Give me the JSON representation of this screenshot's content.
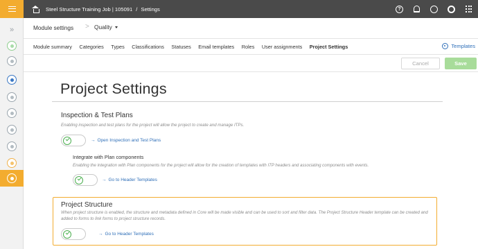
{
  "topbar": {
    "breadcrumb_job": "Steel Structure Training Job | 105091",
    "breadcrumb_sep": "/",
    "breadcrumb_page": "Settings",
    "help_glyph": "?",
    "icons": [
      "home-icon",
      "help-icon",
      "bell-icon",
      "user-icon",
      "settings-icon",
      "apps-grid-icon"
    ]
  },
  "rail": {
    "collapse_glyph": "»",
    "accent_color": "#f3ac2f"
  },
  "module": {
    "title": "Module settings",
    "separator": ">",
    "selected_module": "Quality"
  },
  "tabs": [
    {
      "label": "Module summary",
      "active": false
    },
    {
      "label": "Categories",
      "active": false
    },
    {
      "label": "Types",
      "active": false
    },
    {
      "label": "Classifications",
      "active": false
    },
    {
      "label": "Statuses",
      "active": false
    },
    {
      "label": "Email templates",
      "active": false
    },
    {
      "label": "Roles",
      "active": false
    },
    {
      "label": "User assignments",
      "active": false
    },
    {
      "label": "Project Settings",
      "active": true
    }
  ],
  "templates_link": "Templates",
  "actions": {
    "cancel_label": "Cancel",
    "save_label": "Save"
  },
  "page": {
    "title": "Project Settings"
  },
  "itp": {
    "title": "Inspection & Test Plans",
    "description": "Enabling inspection and test plans for the project will allow the project to create and manage ITPs.",
    "toggle_on": true,
    "link_label": "Open Inspection and Test Plans",
    "plan_components": {
      "title": "Integrate with Plan components",
      "description": "Enabling the integration with Plan components for the project will allow for the creation of templates with ITP headers and associating components with events.",
      "toggle_on": true,
      "link_label": "Go to Header Templates"
    }
  },
  "structure": {
    "title": "Project Structure",
    "description": "When project structure is enabled, the structure and metadata defined in Core will be made visible and can be used to sort and filter data. The Project Structure Header template can be created and added to forms to link forms to project structure records.",
    "toggle_on": true,
    "link_label": "Go to Header Templates"
  },
  "link_arrow": "→"
}
